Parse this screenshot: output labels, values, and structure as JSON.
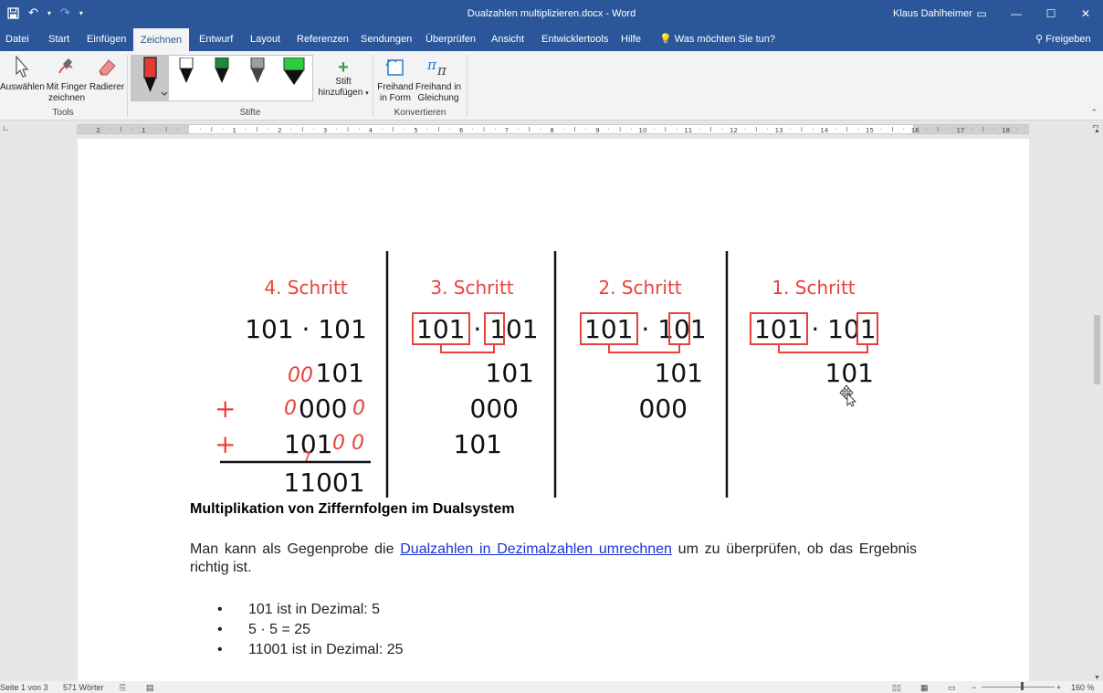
{
  "titlebar": {
    "doc_title": "Dualzahlen multiplizieren.docx  -  Word",
    "user": "Klaus Dahlheimer"
  },
  "tabs": [
    "Datei",
    "Start",
    "Einfügen",
    "Zeichnen",
    "Entwurf",
    "Layout",
    "Referenzen",
    "Sendungen",
    "Überprüfen",
    "Ansicht",
    "Entwicklertools",
    "Hilfe"
  ],
  "active_tab": "Zeichnen",
  "tell_me": "Was möchten Sie tun?",
  "share": "Freigeben",
  "ribbon": {
    "tools": {
      "select": "Auswählen",
      "finger_1": "Mit Finger",
      "finger_2": "zeichnen",
      "eraser": "Radierer",
      "label": "Tools"
    },
    "pens": {
      "label": "Stifte",
      "add_1": "Stift",
      "add_2": "hinzufügen"
    },
    "convert": {
      "shape_1": "Freihand",
      "shape_2": "in Form",
      "math_1": "Freihand in",
      "math_2": "Gleichung",
      "label": "Konvertieren"
    }
  },
  "diagram": {
    "step4": {
      "title": "4. Schritt",
      "expr": "101 · 101",
      "rows": [
        "101",
        "000",
        "101"
      ],
      "result": "11001"
    },
    "step3": {
      "title": "3. Schritt",
      "rows": [
        "101",
        "000",
        "101"
      ]
    },
    "step2": {
      "title": "2. Schritt",
      "rows": [
        "101",
        "000"
      ]
    },
    "step1": {
      "title": "1. Schritt",
      "rows": [
        "101"
      ]
    }
  },
  "heading": "Multiplikation von Ziffernfolgen im Dualsystem",
  "paragraph": {
    "before": "Man kann als Gegenprobe die ",
    "link": "Dualzahlen in Dezimalzahlen umrechnen",
    "after": " um zu überprüfen, ob das Ergebnis richtig ist."
  },
  "bullets": [
    "101 ist in Dezimal: 5",
    "5 · 5 = 25",
    "11001 ist in Dezimal: 25"
  ],
  "status": {
    "page": "Seite 1 von 3",
    "words": "571 Wörter",
    "zoom": "160 %"
  },
  "colors": {
    "word_blue": "#2b579a",
    "red": "#e8413c",
    "black": "#111111"
  }
}
